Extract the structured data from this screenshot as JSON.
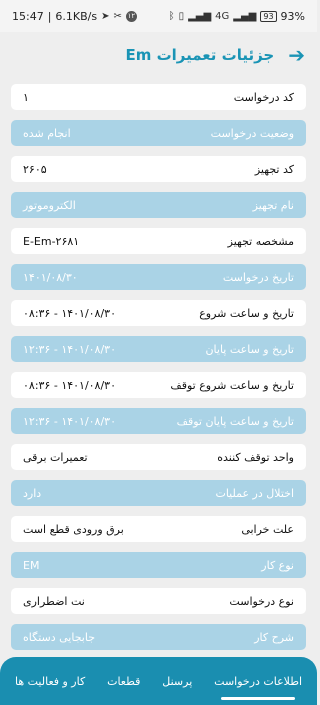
{
  "status_bar": {
    "time": "15:47",
    "speed": "6.1KB/s",
    "badge": "۱۲",
    "signal": "4G",
    "battery_level": "93",
    "battery_percent": "93%"
  },
  "header": {
    "title": "جزئیات تعمیرات Em",
    "back_icon": "arrow-right-icon"
  },
  "rows": [
    {
      "label": "کد درخواست",
      "value": "۱",
      "style": "white"
    },
    {
      "label": "وضعیت درخواست",
      "value": "انجام شده",
      "style": "blue"
    },
    {
      "label": "کد تجهیز",
      "value": "۲۶۰۵",
      "style": "white"
    },
    {
      "label": "نام تجهیز",
      "value": "الکتروموتور",
      "style": "blue"
    },
    {
      "label": "مشخصه تجهیز",
      "value": "E-Em-۲۶۸۱",
      "style": "white"
    },
    {
      "label": "تاریخ درخواست",
      "value": "۱۴۰۱/۰۸/۳۰",
      "style": "blue"
    },
    {
      "label": "تاریخ و ساعت شروع",
      "value": "۱۴۰۱/۰۸/۳۰ - ۰۸:۳۶",
      "style": "white"
    },
    {
      "label": "تاریخ و ساعت پایان",
      "value": "۱۴۰۱/۰۸/۳۰ - ۱۲:۳۶",
      "style": "blue"
    },
    {
      "label": "تاریخ و ساعت شروع توقف",
      "value": "۱۴۰۱/۰۸/۳۰ - ۰۸:۳۶",
      "style": "white"
    },
    {
      "label": "تاریخ و ساعت پایان توقف",
      "value": "۱۴۰۱/۰۸/۳۰ - ۱۲:۳۶",
      "style": "blue"
    },
    {
      "label": "واحد توقف کننده",
      "value": "تعمیرات برقی",
      "style": "white"
    },
    {
      "label": "اختلال در عملیات",
      "value": "دارد",
      "style": "blue"
    },
    {
      "label": "علت خرابی",
      "value": "برق ورودی قطع است",
      "style": "white"
    },
    {
      "label": "نوع کار",
      "value": "EM",
      "style": "blue"
    },
    {
      "label": "نوع درخواست",
      "value": "نت اضطراری",
      "style": "white"
    },
    {
      "label": "شرح کار",
      "value": "جابجایی دستگاه",
      "style": "blue"
    }
  ],
  "bottom_nav": [
    {
      "label": "اطلاعات درخواست",
      "active": true
    },
    {
      "label": "پرسنل",
      "active": false
    },
    {
      "label": "قطعات",
      "active": false
    },
    {
      "label": "کار و فعالیت ها",
      "active": false
    }
  ],
  "colors": {
    "accent": "#1a94b5",
    "row_blue": "#aad3e6",
    "nav_bg": "#1a8eb0"
  }
}
